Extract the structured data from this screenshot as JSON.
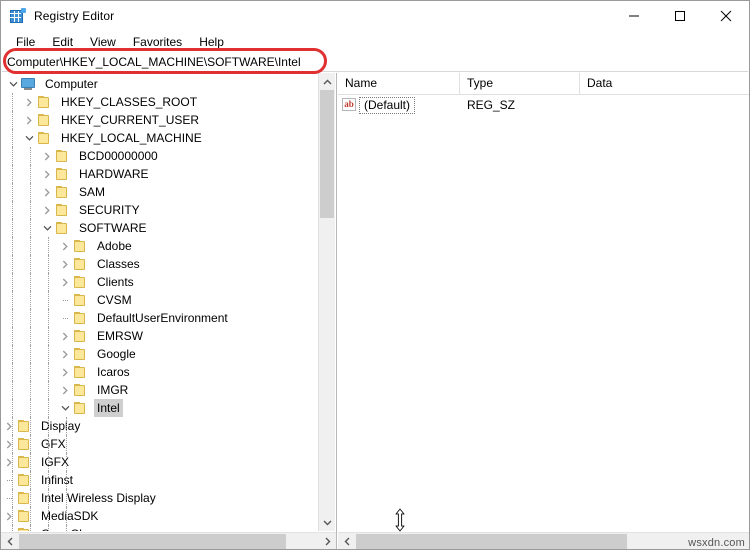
{
  "window": {
    "title": "Registry Editor",
    "icon": "registry-editor-icon",
    "controls": {
      "minimize": "minimize-icon",
      "maximize": "maximize-icon",
      "close": "close-icon"
    }
  },
  "menubar": {
    "items": [
      {
        "label": "File"
      },
      {
        "label": "Edit"
      },
      {
        "label": "View"
      },
      {
        "label": "Favorites"
      },
      {
        "label": "Help"
      }
    ]
  },
  "address": {
    "value": "Computer\\HKEY_LOCAL_MACHINE\\SOFTWARE\\Intel",
    "highlight_color": "#e03030"
  },
  "tree": {
    "nodes": [
      {
        "label": "Computer",
        "indent": 0,
        "twisty": "expanded",
        "icon": "computer-icon",
        "selected": false
      },
      {
        "label": "HKEY_CLASSES_ROOT",
        "indent": 1,
        "twisty": "collapsed",
        "icon": "folder-icon",
        "selected": false
      },
      {
        "label": "HKEY_CURRENT_USER",
        "indent": 1,
        "twisty": "collapsed",
        "icon": "folder-icon",
        "selected": false
      },
      {
        "label": "HKEY_LOCAL_MACHINE",
        "indent": 1,
        "twisty": "expanded",
        "icon": "folder-icon",
        "selected": false
      },
      {
        "label": "BCD00000000",
        "indent": 2,
        "twisty": "collapsed",
        "icon": "folder-icon",
        "selected": false
      },
      {
        "label": "HARDWARE",
        "indent": 2,
        "twisty": "collapsed",
        "icon": "folder-icon",
        "selected": false
      },
      {
        "label": "SAM",
        "indent": 2,
        "twisty": "collapsed",
        "icon": "folder-icon",
        "selected": false
      },
      {
        "label": "SECURITY",
        "indent": 2,
        "twisty": "collapsed",
        "icon": "folder-icon",
        "selected": false
      },
      {
        "label": "SOFTWARE",
        "indent": 2,
        "twisty": "expanded",
        "icon": "folder-icon",
        "selected": false
      },
      {
        "label": "Adobe",
        "indent": 3,
        "twisty": "collapsed",
        "icon": "folder-icon",
        "selected": false
      },
      {
        "label": "Classes",
        "indent": 3,
        "twisty": "collapsed",
        "icon": "folder-icon",
        "selected": false
      },
      {
        "label": "Clients",
        "indent": 3,
        "twisty": "collapsed",
        "icon": "folder-icon",
        "selected": false
      },
      {
        "label": "CVSM",
        "indent": 3,
        "twisty": "leaf",
        "icon": "folder-icon",
        "selected": false
      },
      {
        "label": "DefaultUserEnvironment",
        "indent": 3,
        "twisty": "leaf",
        "icon": "folder-icon",
        "selected": false
      },
      {
        "label": "EMRSW",
        "indent": 3,
        "twisty": "collapsed",
        "icon": "folder-icon",
        "selected": false
      },
      {
        "label": "Google",
        "indent": 3,
        "twisty": "collapsed",
        "icon": "folder-icon",
        "selected": false
      },
      {
        "label": "Icaros",
        "indent": 3,
        "twisty": "collapsed",
        "icon": "folder-icon",
        "selected": false
      },
      {
        "label": "IMGR",
        "indent": 3,
        "twisty": "collapsed",
        "icon": "folder-icon",
        "selected": false
      },
      {
        "label": "Intel",
        "indent": 3,
        "twisty": "expanded",
        "icon": "folder-icon",
        "selected": true
      },
      {
        "label": "Display",
        "indent": 4,
        "twisty": "collapsed",
        "icon": "folder-icon",
        "selected": false
      },
      {
        "label": "GFX",
        "indent": 4,
        "twisty": "collapsed",
        "icon": "folder-icon",
        "selected": false
      },
      {
        "label": "IGFX",
        "indent": 4,
        "twisty": "collapsed",
        "icon": "folder-icon",
        "selected": false
      },
      {
        "label": "Infinst",
        "indent": 4,
        "twisty": "leaf",
        "icon": "folder-icon",
        "selected": false
      },
      {
        "label": "Intel Wireless Display",
        "indent": 4,
        "twisty": "leaf",
        "icon": "folder-icon",
        "selected": false
      },
      {
        "label": "MediaSDK",
        "indent": 4,
        "twisty": "collapsed",
        "icon": "folder-icon",
        "selected": false
      },
      {
        "label": "OpenCL",
        "indent": 4,
        "twisty": "leaf",
        "icon": "folder-icon",
        "selected": false
      }
    ]
  },
  "values_pane": {
    "columns": [
      "Name",
      "Type",
      "Data"
    ],
    "rows": [
      {
        "name": "(Default)",
        "type": "REG_SZ",
        "data": "",
        "icon": "string-value-icon"
      }
    ]
  },
  "cursor": {
    "type": "vertical-resize-cursor"
  },
  "watermark": {
    "text": "wsxdn.com"
  }
}
